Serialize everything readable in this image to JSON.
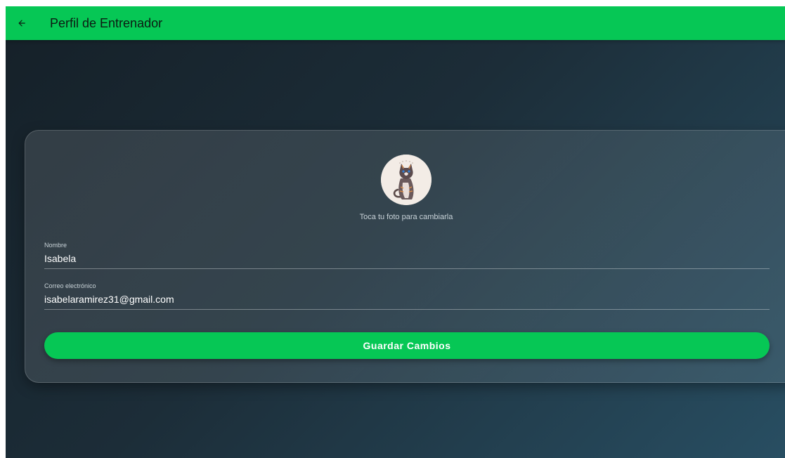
{
  "app_bar": {
    "title": "Perfil de Entrenador",
    "back_icon": "arrow-back-icon",
    "color": "#06c755"
  },
  "profile": {
    "avatar_icon": "cat-avatar-image",
    "avatar_hint": "Toca tu foto para cambiarla"
  },
  "form": {
    "name": {
      "label": "Nombre",
      "value": "Isabela"
    },
    "email": {
      "label": "Correo electrónico",
      "value": "isabelaramirez31@gmail.com"
    }
  },
  "actions": {
    "save_label": "Guardar Cambios"
  },
  "colors": {
    "accent": "#06c755",
    "background_start": "#152028",
    "background_end": "#284e62"
  }
}
